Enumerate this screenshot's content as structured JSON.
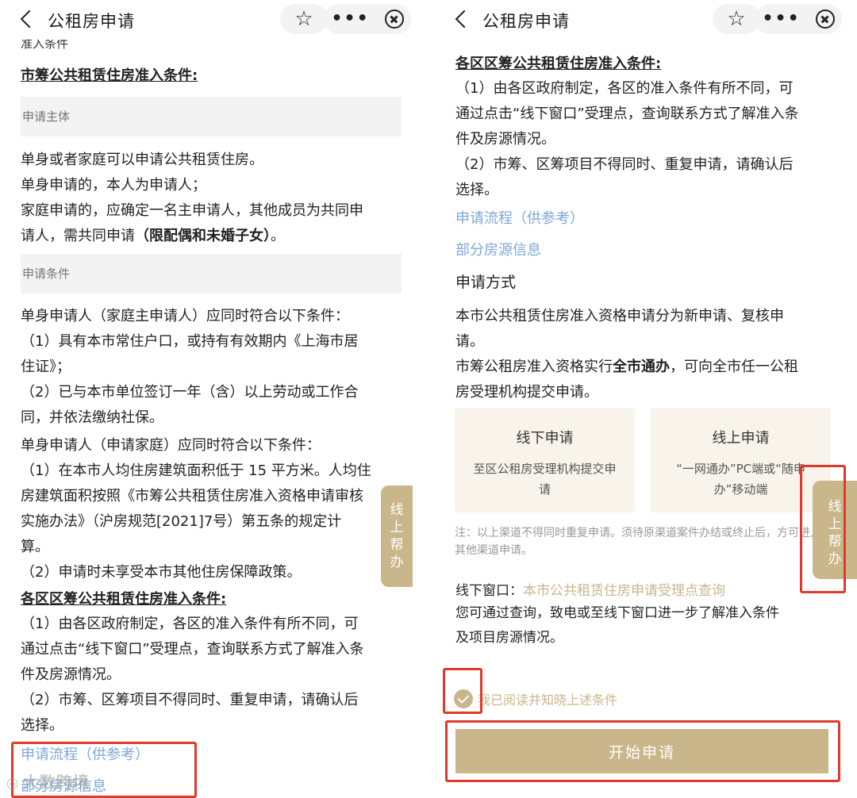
{
  "nav": {
    "title": "公租房申请",
    "star_icon": "☆",
    "more_icon": "•••"
  },
  "left": {
    "cut_top": "准入条件",
    "heading1": "市筹公共租赁住房准入条件:",
    "bar1": "申请主体",
    "subject_lines": [
      "单身或者家庭可以申请公共租赁住房。",
      "单身申请的，本人为申请人；",
      "家庭申请的，应确定一名主申请人，其他成员为共同申",
      "请人，需共同申请"
    ],
    "subject_bold": "（限配偶和未婚子女）",
    "subject_end": "。",
    "bar2": "申请条件",
    "cond_lines": [
      "单身申请人（家庭主申请人）应同时符合以下条件：",
      "（1）具有本市常住户口，或持有有效期内《上海市居",
      "住证》；",
      "（2）已与本市单位签订一年（含）以上劳动或工作合",
      "同，并依法缴纳社保。"
    ],
    "cond2_lines": [
      "单身申请人（申请家庭）应同时符合以下条件：",
      "（1）在本市人均住房建筑面积低于 15 平方米。人均住",
      "房建筑面积按照《市筹公共租赁住房准入资格申请审核",
      "实施办法》（沪房规范[2021]7号）第五条的规定计",
      "算。",
      "（2）申请时未享受本市其他住房保障政策。"
    ],
    "heading2": "各区区筹公共租赁住房准入条件:",
    "district_lines": [
      "（1）由各区政府制定，各区的准入条件有所不同，可",
      "通过点击“线下窗口”受理点，查询联系方式了解准入条",
      "件及房源情况。",
      "（2）市筹、区筹项目不得同时、重复申请，请确认后",
      "选择。"
    ],
    "link_process": "申请流程（供参考）",
    "link_housing": "部分房源信息",
    "side_tab": "线上帮办"
  },
  "right": {
    "heading": "各区区筹公共租赁住房准入条件:",
    "district_lines": [
      "（1）由各区政府制定，各区的准入条件有所不同，可",
      "通过点击“线下窗口”受理点，查询联系方式了解准入条",
      "件及房源情况。",
      "（2）市筹、区筹项目不得同时、重复申请，请确认后",
      "选择。"
    ],
    "link_process": "申请流程（供参考）",
    "link_housing": "部分房源信息",
    "method_title": "申请方式",
    "method_lines": [
      "本市公共租赁住房准入资格申请分为新申请、复核申",
      "请。"
    ],
    "method_line3_pre": "市筹公租房准入资格实行",
    "method_line3_bold": "全市通办",
    "method_line3_post": "，可向全市任一公租",
    "method_line4": "房受理机构提交申请。",
    "card_offline_title": "线下申请",
    "card_offline_desc": "至区公租房受理机构提交申请",
    "card_online_title": "线上申请",
    "card_online_desc": "“一网通办”PC端或“随申办”移动端",
    "note": "注：以上渠道不得同时重复申请。须待原渠道案件办结或终止后，方可进入其他渠道申请。",
    "window_label": "线下窗口：",
    "window_link": "本市公共租赁住房申请受理点查询",
    "window_lines": [
      "您可通过查询，致电或至线下窗口进一步了解准入条件",
      "及项目房源情况。"
    ],
    "agree_label": "我已阅读并知晓上述条件",
    "start_button": "开始申请",
    "side_tab": "线上帮办"
  },
  "watermark": "大数跨境",
  "colors": {
    "accent": "#c9b68a",
    "link": "#7fa7d6",
    "highlight": "#e0392b"
  }
}
